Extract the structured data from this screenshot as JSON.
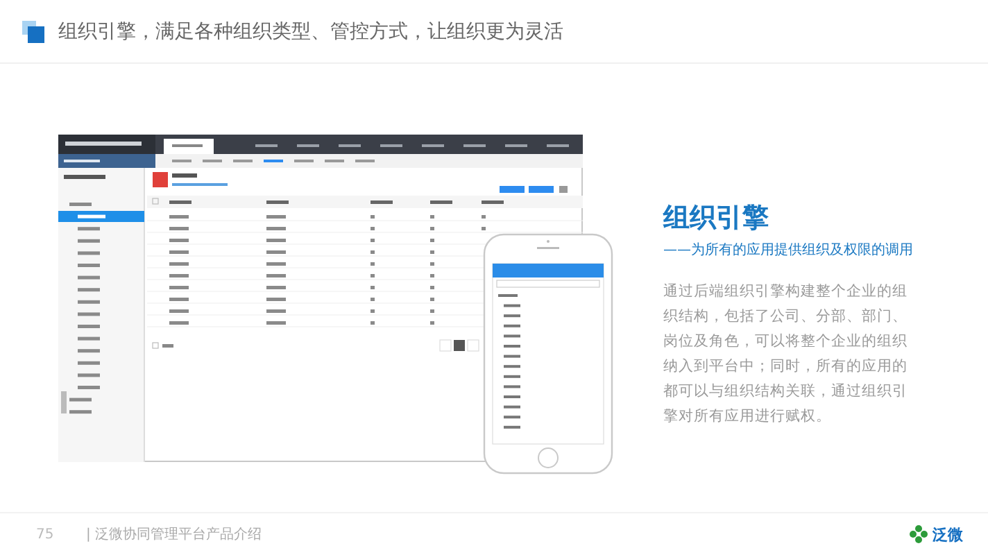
{
  "header": {
    "title": "组织引擎，满足各种组织类型、管控方式，让组织更为灵活"
  },
  "feature": {
    "heading": "组织引擎",
    "subheading": "——为所有的应用提供组织及权限的调用",
    "description": "通过后端组织引擎构建整个企业的组织结构，包括了公司、分部、部门、岗位及角色，可以将整个企业的组织纳入到平台中；同时，所有的应用的都可以与组织结构关联，通过组织引擎对所有应用进行赋权。"
  },
  "footer": {
    "page_number": "75",
    "text": "| 泛微协同管理平台产品介绍",
    "logo_text": "泛微"
  }
}
